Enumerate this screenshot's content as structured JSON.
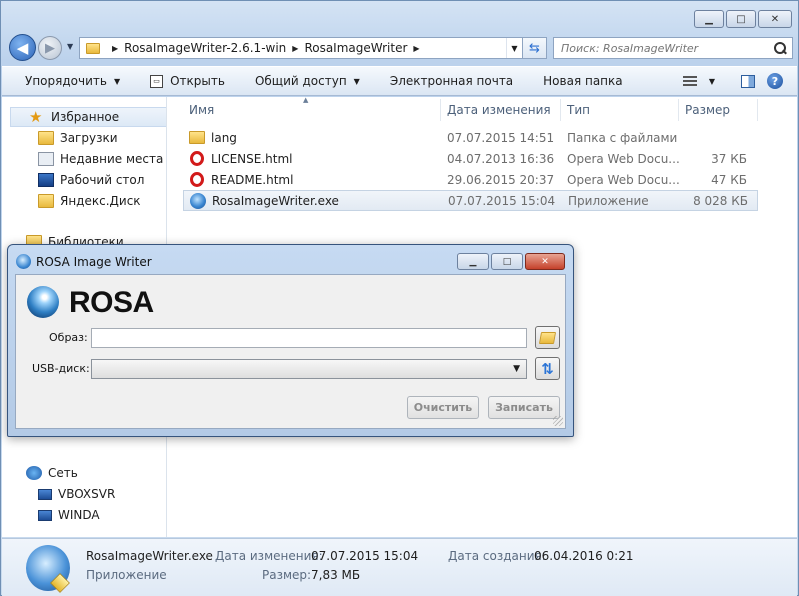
{
  "explorer": {
    "window_controls": {
      "minimize": "▁",
      "maximize": "□",
      "close": "✕"
    },
    "nav": {
      "back_icon": "arrow-left",
      "forward_icon": "arrow-right"
    },
    "breadcrumb": [
      "RosaImageWriter-2.6.1-win",
      "RosaImageWriter"
    ],
    "search": {
      "placeholder": "Поиск: RosaImageWriter"
    },
    "toolbar": {
      "organize": "Упорядочить",
      "open": "Открыть",
      "share": "Общий доступ",
      "email": "Электронная почта",
      "new_folder": "Новая папка"
    },
    "sidebar": {
      "favorites": "Избранное",
      "items": [
        "Загрузки",
        "Недавние места",
        "Рабочий стол",
        "Яндекс.Диск"
      ],
      "libraries": "Библиотеки",
      "network": "Сеть",
      "network_items": [
        "VBOXSVR",
        "WINDA"
      ]
    },
    "columns": {
      "name": "Имя",
      "date": "Дата изменения",
      "type": "Тип",
      "size": "Размер"
    },
    "files": [
      {
        "name": "lang",
        "date": "07.07.2015 14:51",
        "type": "Папка с файлами",
        "size": "",
        "icon": "folder-icon"
      },
      {
        "name": "LICENSE.html",
        "date": "04.07.2013 16:36",
        "type": "Opera Web Docu...",
        "size": "37 КБ",
        "icon": "opera-icon"
      },
      {
        "name": "README.html",
        "date": "29.06.2015 20:37",
        "type": "Opera Web Docu...",
        "size": "47 КБ",
        "icon": "opera-icon"
      },
      {
        "name": "RosaImageWriter.exe",
        "date": "07.07.2015 15:04",
        "type": "Приложение",
        "size": "8 028 КБ",
        "icon": "app-icon"
      }
    ],
    "details": {
      "name": "RosaImageWriter.exe",
      "kind": "Приложение",
      "modified_label": "Дата изменения:",
      "modified_value": "07.07.2015 15:04",
      "size_label": "Размер:",
      "size_value": "7,83 МБ",
      "created_label": "Дата создания:",
      "created_value": "06.04.2016 0:21"
    }
  },
  "rosa": {
    "title": "ROSA Image Writer",
    "logo": "ROSA",
    "image_label": "Образ:",
    "image_value": "",
    "usb_label": "USB-диск:",
    "usb_value": "",
    "clear_button": "Очистить",
    "write_button": "Записать"
  }
}
